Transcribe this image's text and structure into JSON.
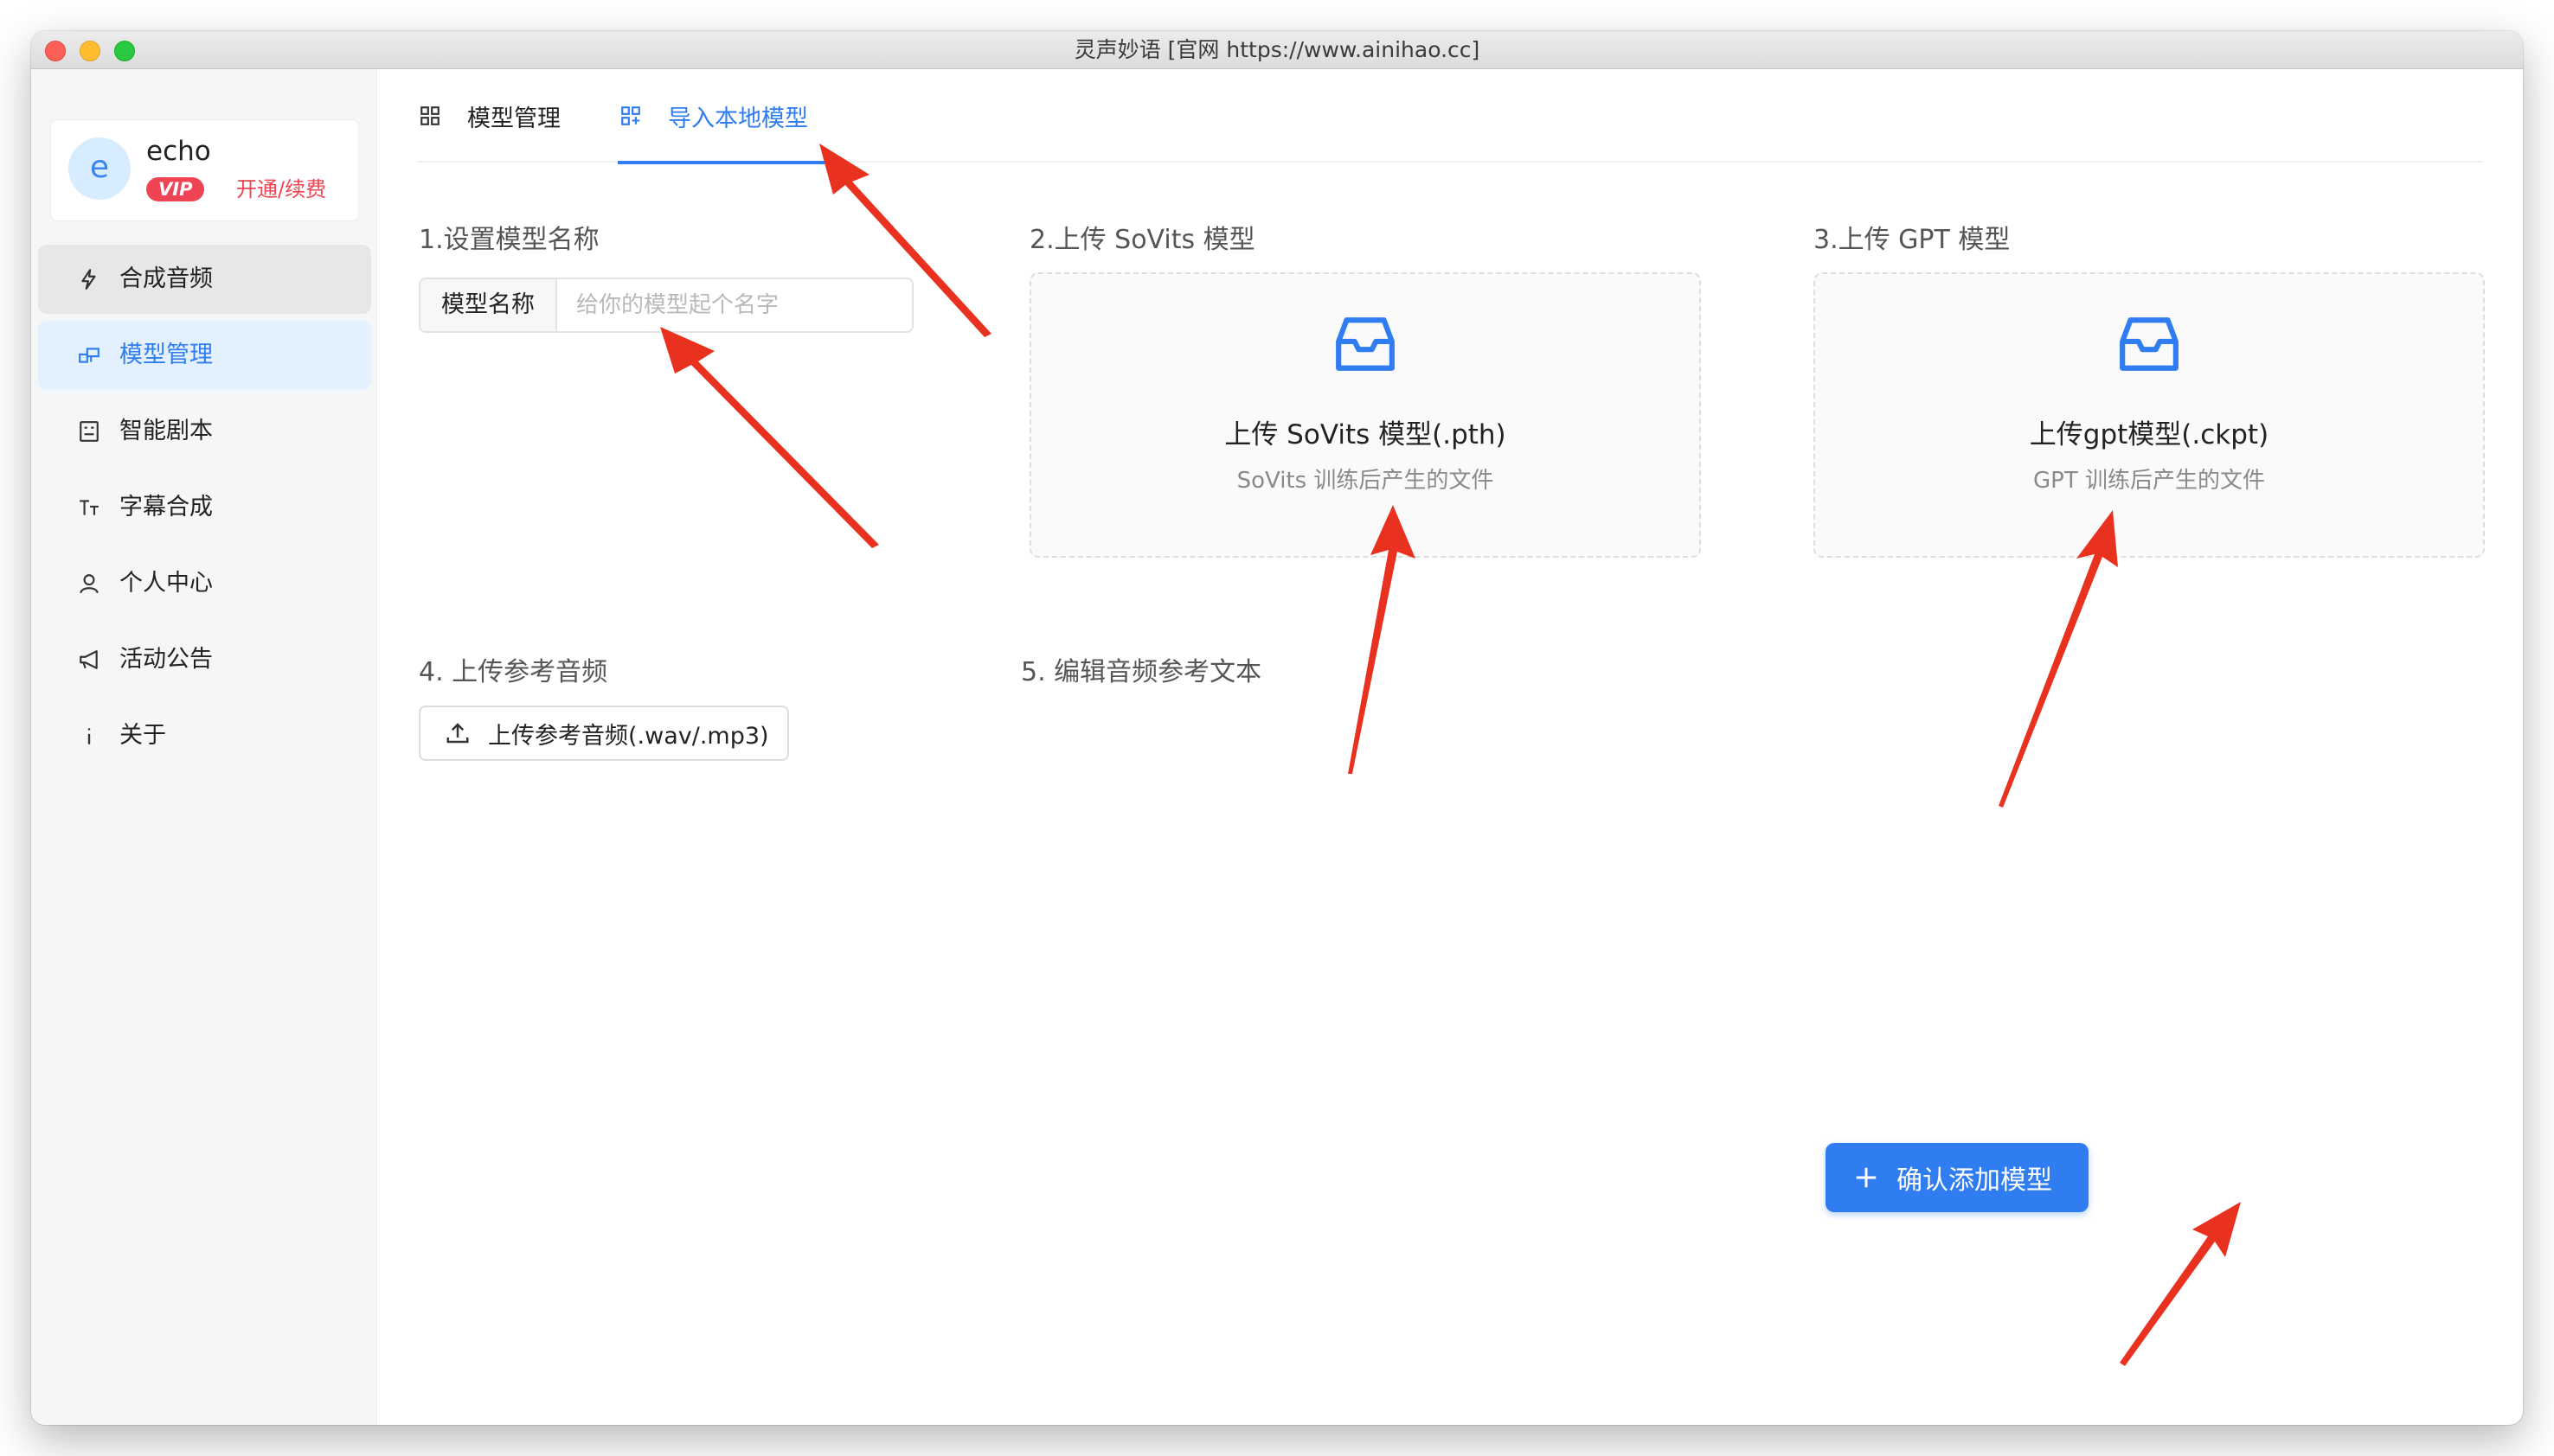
{
  "window": {
    "title": "灵声妙语 [官网 https://www.ainihao.cc]"
  },
  "user": {
    "avatar_letter": "e",
    "name": "echo",
    "vip_label": "VIP",
    "vip_action": "开通/续费"
  },
  "sidebar": {
    "items": [
      {
        "label": "合成音频",
        "icon": "lightning-icon"
      },
      {
        "label": "模型管理",
        "icon": "model-icon"
      },
      {
        "label": "智能剧本",
        "icon": "script-icon"
      },
      {
        "label": "字幕合成",
        "icon": "text-size-icon"
      },
      {
        "label": "个人中心",
        "icon": "user-icon"
      },
      {
        "label": "活动公告",
        "icon": "megaphone-icon"
      },
      {
        "label": "关于",
        "icon": "info-icon"
      }
    ]
  },
  "tabs": [
    {
      "label": "模型管理",
      "icon": "grid-icon"
    },
    {
      "label": "导入本地模型",
      "icon": "import-grid-icon"
    }
  ],
  "sections": {
    "model_name": {
      "title": "1.设置模型名称",
      "addon": "模型名称",
      "placeholder": "给你的模型起个名字",
      "value": ""
    },
    "sovits": {
      "title": "2.上传 SoVits 模型",
      "main_text": "上传 SoVits 模型(.pth)",
      "sub_text": "SoVits 训练后产生的文件"
    },
    "gpt": {
      "title": "3.上传 GPT 模型",
      "main_text": "上传gpt模型(.ckpt)",
      "sub_text": "GPT 训练后产生的文件"
    },
    "ref_audio": {
      "title": "4. 上传参考音频",
      "button_label": "上传参考音频(.wav/.mp3)"
    },
    "ref_text": {
      "title": "5. 编辑音频参考文本"
    }
  },
  "confirm_button": {
    "label": "确认添加模型"
  },
  "colors": {
    "accent": "#2f7df0",
    "vip": "#ee4454",
    "annotation_arrow": "#e8321f"
  }
}
